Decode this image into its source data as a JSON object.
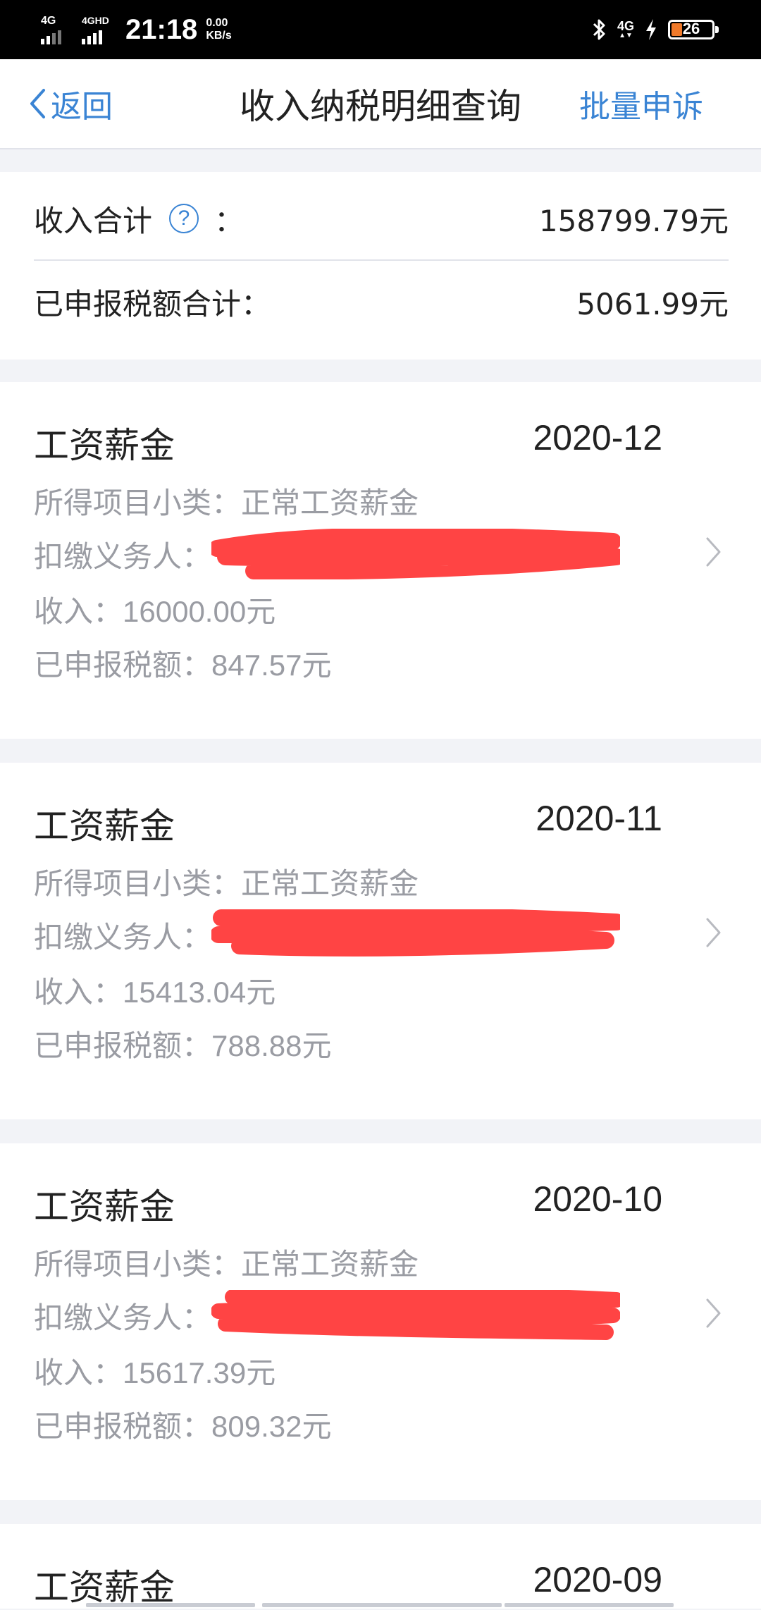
{
  "status_bar": {
    "network1": "4G",
    "network2": "4GHD",
    "time": "21:18",
    "speed_value": "0.00",
    "speed_unit": "KB/s",
    "network3": "4G",
    "battery": "26",
    "battery_level": 0.26,
    "battery_color": "#f07a2b"
  },
  "nav": {
    "back_label": "返回",
    "title": "收入纳税明细查询",
    "action_label": "批量申诉",
    "accent_color": "#3a84d4"
  },
  "summary": {
    "income_label": "收入合计",
    "income_colon": "：",
    "income_value": "158799.79元",
    "tax_label": "已申报税额合计：",
    "tax_value": "5061.99元",
    "help_icon": "?"
  },
  "records": [
    {
      "title": "工资薪金",
      "month": "2020-12",
      "subcategory_label": "所得项目小类：",
      "subcategory_value": "正常工资薪金",
      "withholder_label": "扣缴义务人：",
      "income_label": "收入：",
      "income_value": "16000.00元",
      "tax_label": "已申报税额：",
      "tax_value": "847.57元"
    },
    {
      "title": "工资薪金",
      "month": "2020-11",
      "subcategory_label": "所得项目小类：",
      "subcategory_value": "正常工资薪金",
      "withholder_label": "扣缴义务人：",
      "income_label": "收入：",
      "income_value": "15413.04元",
      "tax_label": "已申报税额：",
      "tax_value": "788.88元"
    },
    {
      "title": "工资薪金",
      "month": "2020-10",
      "subcategory_label": "所得项目小类：",
      "subcategory_value": "正常工资薪金",
      "withholder_label": "扣缴义务人：",
      "income_label": "收入：",
      "income_value": "15617.39元",
      "tax_label": "已申报税额：",
      "tax_value": "809.32元"
    },
    {
      "title": "工资薪金",
      "month": "2020-09"
    }
  ],
  "redaction_color": "#ff4444"
}
